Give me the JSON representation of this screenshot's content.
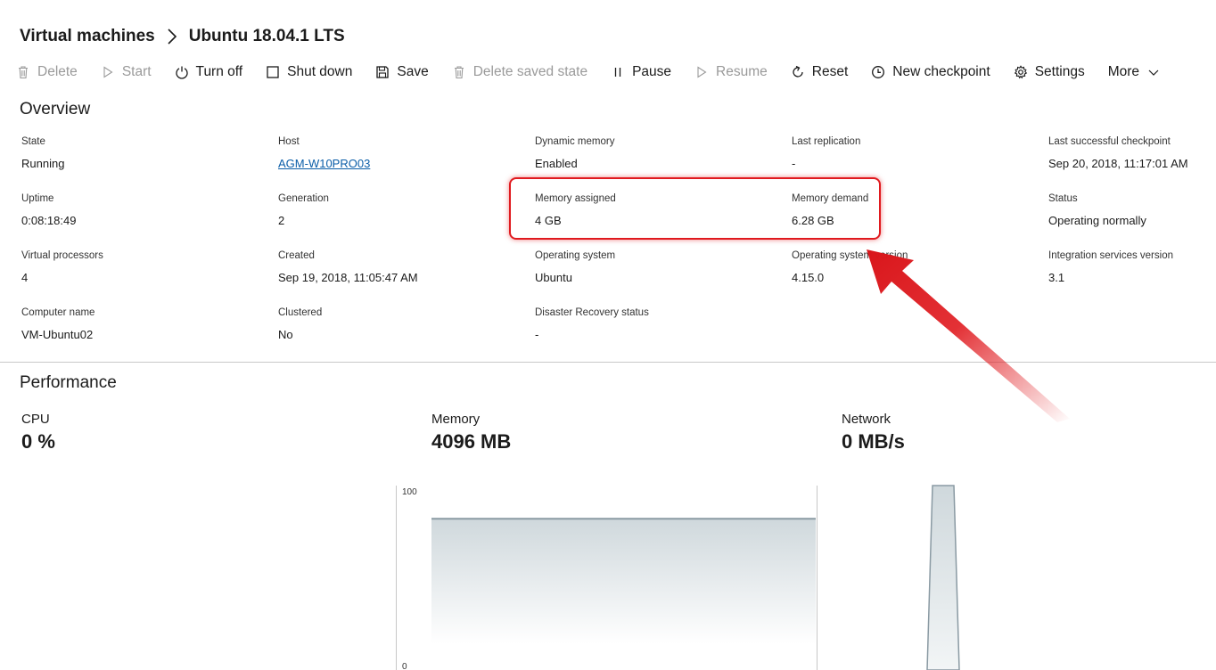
{
  "breadcrumb": {
    "root": "Virtual machines",
    "current": "Ubuntu 18.04.1 LTS"
  },
  "toolbar": {
    "items": [
      {
        "label": "Delete",
        "icon": "trash-icon",
        "enabled": false
      },
      {
        "label": "Start",
        "icon": "play-icon",
        "enabled": false
      },
      {
        "label": "Turn off",
        "icon": "power-icon",
        "enabled": true
      },
      {
        "label": "Shut down",
        "icon": "square-icon",
        "enabled": true
      },
      {
        "label": "Save",
        "icon": "floppy-disk-icon",
        "enabled": true
      },
      {
        "label": "Delete saved state",
        "icon": "trash-icon",
        "enabled": false
      },
      {
        "label": "Pause",
        "icon": "pause-icon",
        "enabled": true
      },
      {
        "label": "Resume",
        "icon": "play-icon",
        "enabled": false
      },
      {
        "label": "Reset",
        "icon": "refresh-icon",
        "enabled": true
      },
      {
        "label": "New checkpoint",
        "icon": "clock-icon",
        "enabled": true
      },
      {
        "label": "Settings",
        "icon": "gear-icon",
        "enabled": true
      },
      {
        "label": "More",
        "icon": "chevron-down-icon",
        "enabled": true
      }
    ]
  },
  "overview": {
    "title": "Overview",
    "fields": {
      "state": {
        "label": "State",
        "value": "Running"
      },
      "host": {
        "label": "Host",
        "value": "AGM-W10PRO03"
      },
      "dynamic_memory": {
        "label": "Dynamic memory",
        "value": "Enabled"
      },
      "last_replication": {
        "label": "Last replication",
        "value": "-"
      },
      "last_checkpoint": {
        "label": "Last successful checkpoint",
        "value": "Sep 20, 2018, 11:17:01 AM"
      },
      "uptime": {
        "label": "Uptime",
        "value": "0:08:18:49"
      },
      "generation": {
        "label": "Generation",
        "value": "2"
      },
      "memory_assigned": {
        "label": "Memory assigned",
        "value": "4 GB"
      },
      "memory_demand": {
        "label": "Memory demand",
        "value": "6.28 GB"
      },
      "status": {
        "label": "Status",
        "value": "Operating normally"
      },
      "virtual_processors": {
        "label": "Virtual processors",
        "value": "4"
      },
      "created": {
        "label": "Created",
        "value": "Sep 19, 2018, 11:05:47 AM"
      },
      "operating_system": {
        "label": "Operating system",
        "value": "Ubuntu"
      },
      "os_version": {
        "label": "Operating system version",
        "value": "4.15.0"
      },
      "integration_services": {
        "label": "Integration services version",
        "value": "3.1"
      },
      "computer_name": {
        "label": "Computer name",
        "value": "VM-Ubuntu02"
      },
      "clustered": {
        "label": "Clustered",
        "value": "No"
      },
      "disaster_recovery": {
        "label": "Disaster Recovery status",
        "value": "-"
      }
    }
  },
  "performance": {
    "title": "Performance",
    "cpu": {
      "label": "CPU",
      "value": "0 %"
    },
    "memory": {
      "label": "Memory",
      "value": "4096 MB"
    },
    "network": {
      "label": "Network",
      "value": "0 MB/s"
    },
    "memory_chart": {
      "y_max_label": "100",
      "y_min_label": "0",
      "fill_level_percent": 82
    }
  },
  "colors": {
    "link": "#0b5ea8",
    "highlight": "#e01a1f",
    "disabled_text": "#9a9a9a",
    "chart_line": "#8a9aa3"
  }
}
